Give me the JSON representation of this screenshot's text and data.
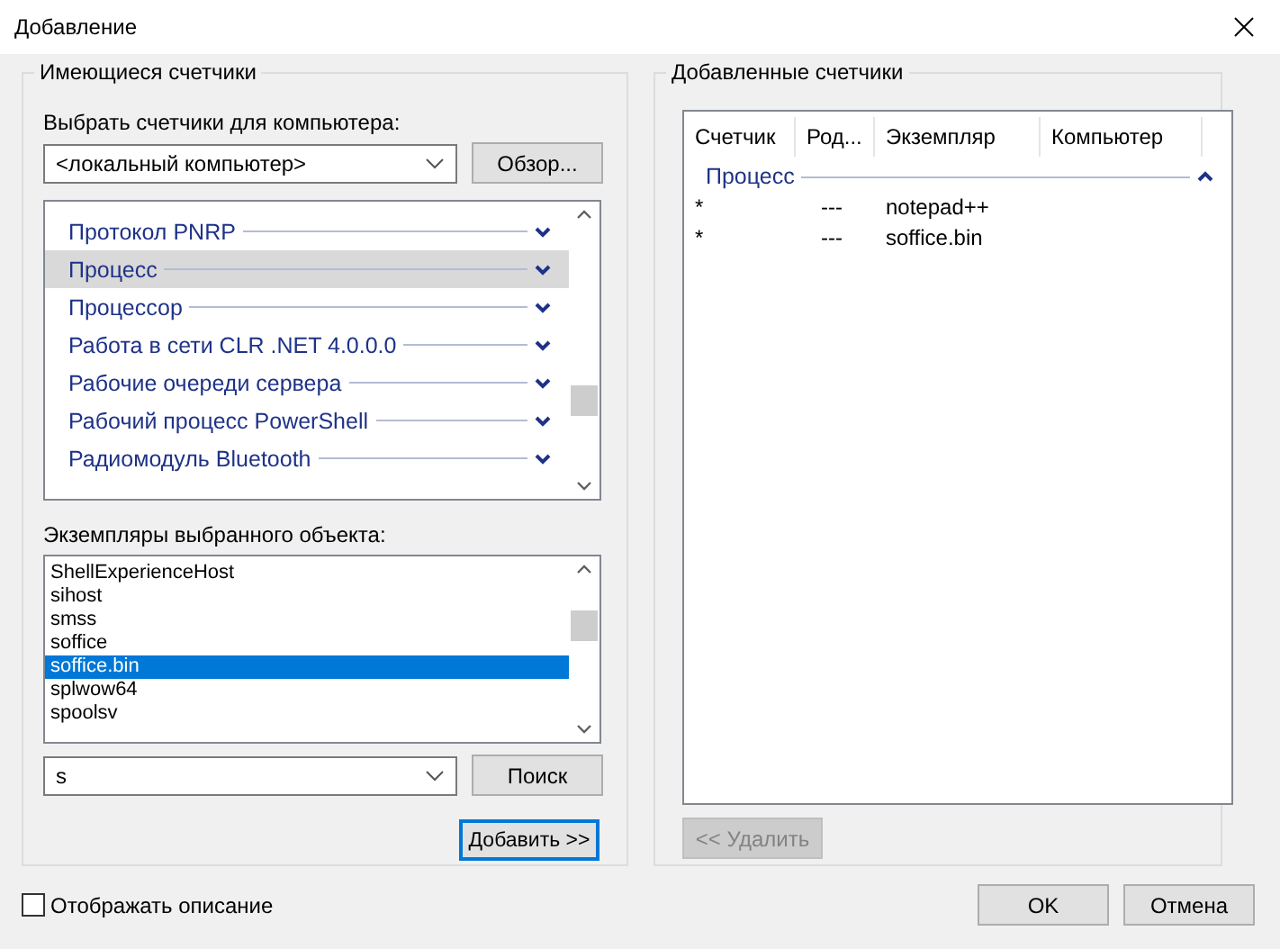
{
  "window": {
    "title": "Добавление"
  },
  "available": {
    "title": "Имеющиеся счетчики",
    "computer_label": "Выбрать счетчики для компьютера:",
    "computer": "<локальный компьютер>",
    "browse_button": "Обзор...",
    "objects": [
      {
        "label": "Протокол PNRP",
        "selected": false
      },
      {
        "label": "Процесс",
        "selected": true
      },
      {
        "label": "Процессор",
        "selected": false
      },
      {
        "label": "Работа в сети CLR .NET 4.0.0.0",
        "selected": false
      },
      {
        "label": "Рабочие очереди сервера",
        "selected": false
      },
      {
        "label": "Рабочий процесс PowerShell",
        "selected": false
      },
      {
        "label": "Радиомодуль Bluetooth",
        "selected": false
      }
    ],
    "instances_label": "Экземпляры выбранного объекта:",
    "instances": [
      {
        "label": "ShellExperienceHost",
        "selected": false
      },
      {
        "label": "sihost",
        "selected": false
      },
      {
        "label": "smss",
        "selected": false
      },
      {
        "label": "soffice",
        "selected": false
      },
      {
        "label": "soffice.bin",
        "selected": true
      },
      {
        "label": "splwow64",
        "selected": false
      },
      {
        "label": "spoolsv",
        "selected": false
      }
    ],
    "search_value": "s",
    "search_button": "Поиск",
    "add_button": "Добавить >>"
  },
  "added": {
    "title": "Добавленные счетчики",
    "columns": [
      "Счетчик",
      "Род...",
      "Экземпляр",
      "Компьютер"
    ],
    "groups": [
      {
        "name": "Процесс",
        "expanded": true,
        "rows": [
          {
            "counter": "*",
            "parent": "---",
            "instance": "notepad++"
          },
          {
            "counter": "*",
            "parent": "---",
            "instance": "soffice.bin"
          }
        ]
      }
    ],
    "remove_button": {
      "label": "<< Удалить",
      "disabled": true
    }
  },
  "show_description": {
    "label": "Отображать описание",
    "checked": false
  },
  "buttons": [
    "OK",
    "Отмена"
  ]
}
